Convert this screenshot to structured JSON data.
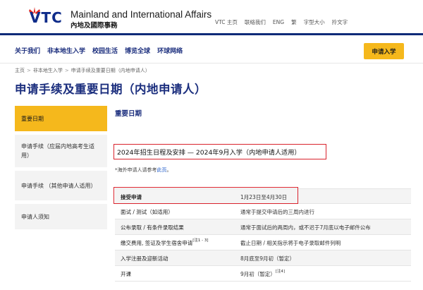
{
  "header": {
    "logo_text": "VTC",
    "org_name_en": "Mainland and International Affairs",
    "org_name_zh": "內地及國際事務",
    "util_nav": [
      "VTC 主页",
      "联絡我们",
      "ENG",
      "繁",
      "字型大小",
      "拎文字"
    ]
  },
  "nav": {
    "items": [
      "关于我们",
      "非本地生入学",
      "校园生活",
      "博览全球",
      "环球网络"
    ],
    "apply_label": "申请入学"
  },
  "breadcrumb": [
    "主页",
    "非本地生入学",
    "申请手续及重要日期（内地申请人）"
  ],
  "page_title": "申请手续及重要日期（内地申请人）",
  "sidebar": {
    "items": [
      "重要日期",
      "申请手续（应届内地高考生适用）",
      "申请手续 （其他申请人适用）",
      "申请人须知"
    ]
  },
  "content": {
    "section_heading": "重要日期",
    "schedule_title": "2024年招生日程及安排 — 2024年9月入学（内地申请人适用）",
    "note_prefix": "*海外申请人请参考",
    "note_link": "此页",
    "note_suffix": "。",
    "rows": [
      {
        "label": "接受申请",
        "value": "1月23日至4月30日",
        "sup": "",
        "value_sup": ""
      },
      {
        "label": "面试 / 测试（如适用）",
        "value": "通常于提交申请后的三周内进行",
        "sup": "",
        "value_sup": ""
      },
      {
        "label": "公布录取 / 有条件录取结果",
        "value": "通常于面试后的两周内，或不迟于7月底以电子邮件公布",
        "sup": "",
        "value_sup": ""
      },
      {
        "label": "缴交费用, 签证及学生宿舍申请",
        "value": "截止日期 / 相关指示将于电子录取邮件列明",
        "sup": "[注1 - 3]",
        "value_sup": ""
      },
      {
        "label": "入学注册及迎新活动",
        "value": "8月底至9月初（暂定）",
        "sup": "",
        "value_sup": ""
      },
      {
        "label": "开课",
        "value": "9月初（暂定）",
        "sup": "",
        "value_sup": "[注4]"
      }
    ]
  },
  "colors": {
    "brand_navy": "#0d2a78",
    "title_blue": "#1c2f7e",
    "accent_yellow": "#f5b81c",
    "highlight_red": "#d9232d"
  }
}
